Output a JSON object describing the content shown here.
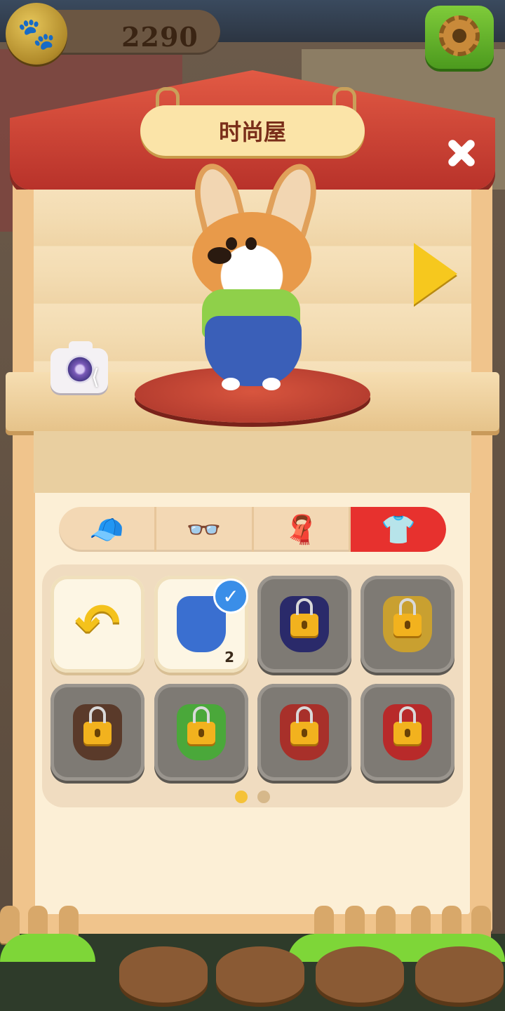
{
  "hud": {
    "coins": "2290"
  },
  "panel": {
    "title": "时尚屋"
  },
  "tabs": [
    {
      "name": "hat",
      "icon": "cap-icon",
      "glyph": "🧢",
      "active": false
    },
    {
      "name": "glasses",
      "icon": "glasses-icon",
      "glyph": "👓",
      "active": false
    },
    {
      "name": "scarf",
      "icon": "scarf-icon",
      "glyph": "🧣",
      "active": false
    },
    {
      "name": "clothes",
      "icon": "shirt-icon",
      "glyph": "👕",
      "active": true
    }
  ],
  "wardrobe": {
    "slots": [
      {
        "kind": "reset",
        "owned": true
      },
      {
        "kind": "outfit-overalls",
        "owned": true,
        "selected": true,
        "count": "2",
        "color": "#3a6fd0"
      },
      {
        "kind": "outfit-navy-jacket",
        "owned": false,
        "color": "#2a2a6a"
      },
      {
        "kind": "outfit-gold-vest",
        "owned": false,
        "color": "#c9a030"
      },
      {
        "kind": "outfit-brown-coat",
        "owned": false,
        "color": "#5a3a2a"
      },
      {
        "kind": "outfit-grass-skirt",
        "owned": false,
        "color": "#4aa83a"
      },
      {
        "kind": "outfit-red-coat",
        "owned": false,
        "color": "#a8302a"
      },
      {
        "kind": "outfit-red-poncho",
        "owned": false,
        "color": "#b82a2a"
      }
    ],
    "pages": 2,
    "current_page": 1
  }
}
